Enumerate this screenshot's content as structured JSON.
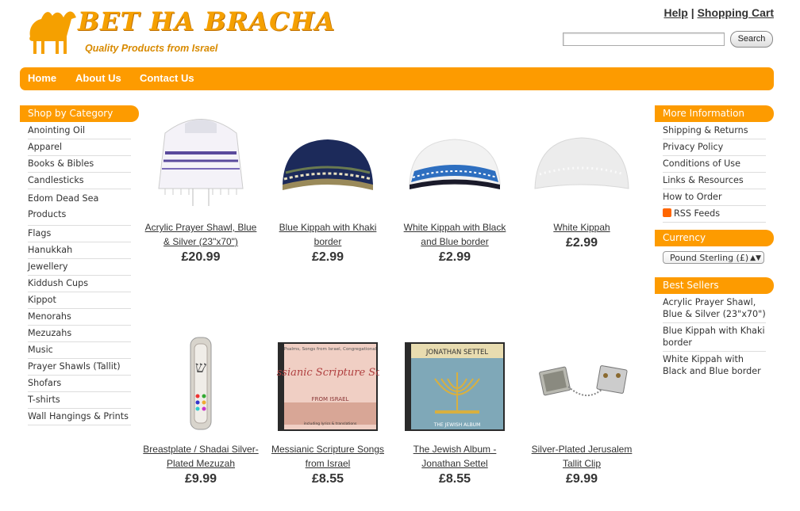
{
  "header": {
    "brand": "BET HA BRACHA",
    "tagline": "Quality Products from Israel",
    "links": [
      "Help",
      "Shopping Cart"
    ],
    "separator": "|",
    "search_placeholder": "",
    "search_button": "Search"
  },
  "nav": [
    "Home",
    "About Us",
    "Contact Us"
  ],
  "categories": {
    "title": "Shop by Category",
    "items": [
      "Anointing Oil",
      "Apparel",
      "Books & Bibles",
      "Candlesticks",
      "Edom Dead Sea Products",
      "Flags",
      "Hanukkah",
      "Jewellery",
      "Kiddush Cups",
      "Kippot",
      "Menorahs",
      "Mezuzahs",
      "Music",
      "Prayer Shawls (Tallit)",
      "Shofars",
      "T-shirts",
      "Wall Hangings & Prints"
    ]
  },
  "info": {
    "title": "More Information",
    "items": [
      "Shipping & Returns",
      "Privacy Policy",
      "Conditions of Use",
      "Links & Resources",
      "How to Order",
      "RSS Feeds"
    ]
  },
  "currency": {
    "title": "Currency",
    "selected": "Pound Sterling (£)"
  },
  "bestsellers": {
    "title": "Best Sellers",
    "items": [
      "Acrylic Prayer Shawl, Blue & Silver (23\"x70\")",
      "Blue Kippah with Khaki border",
      "White Kippah with Black and Blue border"
    ]
  },
  "products": [
    {
      "name": "Acrylic Prayer Shawl, Blue & Silver (23\"x70\")",
      "price": "£20.99",
      "icon": "prayer-shawl-image"
    },
    {
      "name": "Blue Kippah with Khaki border",
      "price": "£2.99",
      "icon": "blue-kippah-image"
    },
    {
      "name": "White Kippah with Black and Blue border",
      "price": "£2.99",
      "icon": "white-blue-kippah-image"
    },
    {
      "name": "White Kippah",
      "price": "£2.99",
      "icon": "white-kippah-image"
    },
    {
      "name": "Breastplate / Shadai Silver-Plated Mezuzah",
      "price": "£9.99",
      "icon": "mezuzah-image"
    },
    {
      "name": "Messianic Scripture Songs from Israel",
      "price": "£8.55",
      "icon": "cd-image"
    },
    {
      "name": "The Jewish Album - Jonathan Settel",
      "price": "£8.55",
      "icon": "cd-image"
    },
    {
      "name": "Silver-Plated Jerusalem Tallit Clip",
      "price": "£9.99",
      "icon": "tallit-clip-image"
    }
  ],
  "cd_covers": {
    "messianic": {
      "top": "Psalms, Songs from Israel, Congregational",
      "title": "Messianic Scripture Songs",
      "sub": "FROM ISRAEL",
      "foot": "including lyrics & translations"
    },
    "jewish": {
      "title": "JONATHAN SETTEL",
      "sub": "THE JEWISH ALBUM"
    }
  },
  "colors": {
    "accent": "#fd9b00",
    "brand": "#f5a000"
  }
}
